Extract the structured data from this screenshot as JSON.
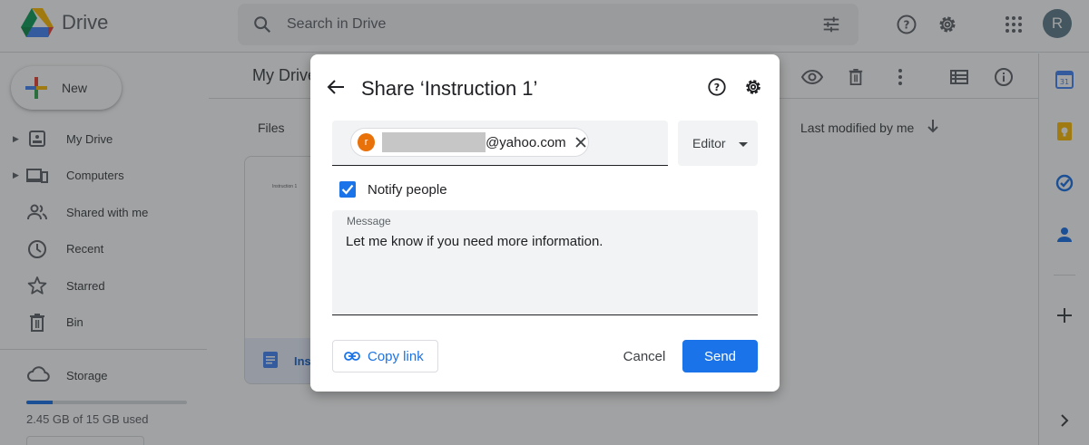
{
  "app": {
    "name": "Drive",
    "avatar_letter": "R"
  },
  "search": {
    "placeholder": "Search in Drive"
  },
  "sidebar": {
    "new_label": "New",
    "items": [
      {
        "label": "My Drive",
        "icon": "my-drive-icon",
        "expandable": true
      },
      {
        "label": "Computers",
        "icon": "computers-icon",
        "expandable": true
      },
      {
        "label": "Shared with me",
        "icon": "shared-icon",
        "expandable": false
      },
      {
        "label": "Recent",
        "icon": "clock-icon",
        "expandable": false
      },
      {
        "label": "Starred",
        "icon": "star-icon",
        "expandable": false
      },
      {
        "label": "Bin",
        "icon": "bin-icon",
        "expandable": false
      }
    ],
    "storage_label": "Storage",
    "storage_used": "2.45 GB of 15 GB used",
    "storage_fraction": 0.163
  },
  "main": {
    "breadcrumb": "My Drive",
    "files_label": "Files",
    "sort_label": "Last modified by me",
    "file_card": {
      "name": "Ins",
      "thumb_text": "Instruction 1"
    }
  },
  "dialog": {
    "title": "Share ‘Instruction 1’",
    "recipient": {
      "avatar_letter": "r",
      "email_suffix": "@yahoo.com"
    },
    "role": "Editor",
    "notify_label": "Notify people",
    "notify_checked": true,
    "message_label": "Message",
    "message_text": "Let me know if you need more information.",
    "copy_link_label": "Copy link",
    "cancel_label": "Cancel",
    "send_label": "Send"
  },
  "colors": {
    "accent": "#1a73e8",
    "avatar_bg": "#5f7c8a",
    "chip_avatar": "#e8710a"
  }
}
